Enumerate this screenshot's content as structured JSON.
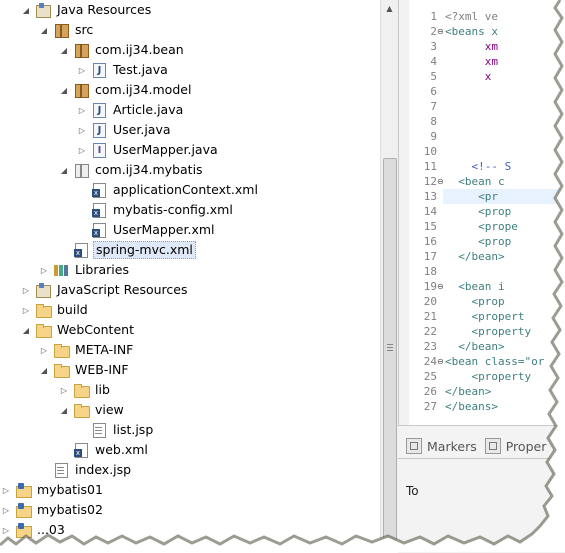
{
  "tree": {
    "items": [
      {
        "label": "Java Resources",
        "icon": "java-resources-icon",
        "expand": "open",
        "selected": false
      },
      {
        "label": "src",
        "icon": "source-folder-icon",
        "expand": "open",
        "selected": false
      },
      {
        "label": "com.ij34.bean",
        "icon": "package-icon",
        "expand": "open",
        "selected": false
      },
      {
        "label": "Test.java",
        "icon": "java-file-icon",
        "expand": "closed",
        "selected": false
      },
      {
        "label": "com.ij34.model",
        "icon": "package-icon",
        "expand": "open",
        "selected": false
      },
      {
        "label": "Article.java",
        "icon": "java-file-icon",
        "expand": "closed",
        "selected": false
      },
      {
        "label": "User.java",
        "icon": "java-file-icon",
        "expand": "closed",
        "selected": false
      },
      {
        "label": "UserMapper.java",
        "icon": "java-interface-icon",
        "expand": "closed",
        "selected": false
      },
      {
        "label": "com.ij34.mybatis",
        "icon": "package-white-icon",
        "expand": "open",
        "selected": false
      },
      {
        "label": "applicationContext.xml",
        "icon": "xml-file-icon",
        "expand": "none",
        "selected": false
      },
      {
        "label": "mybatis-config.xml",
        "icon": "xml-file-icon",
        "expand": "none",
        "selected": false
      },
      {
        "label": "UserMapper.xml",
        "icon": "xml-file-icon",
        "expand": "none",
        "selected": false
      },
      {
        "label": "spring-mvc.xml",
        "icon": "xml-file-icon",
        "expand": "none",
        "selected": true
      },
      {
        "label": "Libraries",
        "icon": "library-icon",
        "expand": "closed",
        "selected": false
      },
      {
        "label": "JavaScript Resources",
        "icon": "javascript-resources-icon",
        "expand": "closed",
        "selected": false
      },
      {
        "label": "build",
        "icon": "folder-icon",
        "expand": "closed",
        "selected": false
      },
      {
        "label": "WebContent",
        "icon": "folder-icon",
        "expand": "open",
        "selected": false
      },
      {
        "label": "META-INF",
        "icon": "folder-icon",
        "expand": "closed",
        "selected": false
      },
      {
        "label": "WEB-INF",
        "icon": "folder-icon",
        "expand": "open",
        "selected": false
      },
      {
        "label": "lib",
        "icon": "folder-icon",
        "expand": "closed",
        "selected": false
      },
      {
        "label": "view",
        "icon": "folder-icon",
        "expand": "open",
        "selected": false
      },
      {
        "label": "list.jsp",
        "icon": "jsp-file-icon",
        "expand": "none",
        "selected": false
      },
      {
        "label": "web.xml",
        "icon": "xml-file-icon",
        "expand": "none",
        "selected": false
      },
      {
        "label": "index.jsp",
        "icon": "jsp-file-icon",
        "expand": "none",
        "selected": false
      },
      {
        "label": "mybatis01",
        "icon": "project-icon",
        "expand": "closed",
        "selected": false
      },
      {
        "label": "mybatis02",
        "icon": "project-icon",
        "expand": "closed",
        "selected": false
      },
      {
        "label": "...03",
        "icon": "project-icon",
        "expand": "closed",
        "selected": false
      }
    ]
  },
  "editor": {
    "lines": [
      {
        "n": "1",
        "text": "<?xml ve",
        "style": "decl",
        "fold": ""
      },
      {
        "n": "2",
        "text": "<beans x",
        "style": "tag",
        "fold": "⊖"
      },
      {
        "n": "3",
        "text": "      xm",
        "style": "attr",
        "fold": ""
      },
      {
        "n": "4",
        "text": "      xm",
        "style": "attr",
        "fold": ""
      },
      {
        "n": "5",
        "text": "      x",
        "style": "attr",
        "fold": ""
      },
      {
        "n": "6",
        "text": "",
        "style": "tag",
        "fold": ""
      },
      {
        "n": "7",
        "text": "",
        "style": "tag",
        "fold": ""
      },
      {
        "n": "8",
        "text": "",
        "style": "tag",
        "fold": ""
      },
      {
        "n": "9",
        "text": "",
        "style": "tag",
        "fold": ""
      },
      {
        "n": "10",
        "text": "",
        "style": "tag",
        "fold": ""
      },
      {
        "n": "11",
        "text": "    <!-- S",
        "style": "comment",
        "fold": ""
      },
      {
        "n": "12",
        "text": "  <bean c",
        "style": "tag",
        "fold": "⊖"
      },
      {
        "n": "13",
        "text": "     <pr",
        "style": "tag",
        "fold": ""
      },
      {
        "n": "14",
        "text": "     <prop",
        "style": "tag",
        "fold": ""
      },
      {
        "n": "15",
        "text": "     <prope",
        "style": "tag",
        "fold": ""
      },
      {
        "n": "16",
        "text": "     <prop",
        "style": "tag",
        "fold": ""
      },
      {
        "n": "17",
        "text": "  </bean>",
        "style": "tag",
        "fold": ""
      },
      {
        "n": "18",
        "text": "",
        "style": "tag",
        "fold": ""
      },
      {
        "n": "19",
        "text": "  <bean i",
        "style": "tag",
        "fold": "⊖"
      },
      {
        "n": "20",
        "text": "    <prop",
        "style": "tag",
        "fold": ""
      },
      {
        "n": "21",
        "text": "    <propert",
        "style": "tag",
        "fold": ""
      },
      {
        "n": "22",
        "text": "    <property",
        "style": "tag",
        "fold": ""
      },
      {
        "n": "23",
        "text": "  </bean>",
        "style": "tag",
        "fold": ""
      },
      {
        "n": "24",
        "text": "<bean class=\"or",
        "style": "tag",
        "fold": "⊖"
      },
      {
        "n": "25",
        "text": "    <property",
        "style": "tag",
        "fold": ""
      },
      {
        "n": "26",
        "text": "</bean>",
        "style": "tag",
        "fold": ""
      },
      {
        "n": "27",
        "text": "</beans>",
        "style": "tag",
        "fold": ""
      }
    ],
    "highlighted_line": "13"
  },
  "views": {
    "tabs": [
      {
        "label": "Markers",
        "icon": "markers-icon"
      },
      {
        "label": "Proper",
        "icon": "properties-icon"
      }
    ],
    "content_text": "To"
  }
}
